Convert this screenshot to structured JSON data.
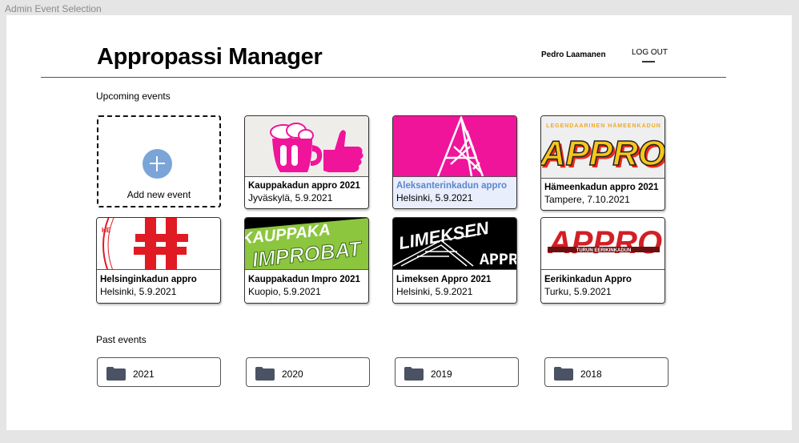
{
  "frame_label": "Admin Event Selection",
  "header": {
    "title": "Appropassi Manager",
    "user_name": "Pedro Laamanen",
    "logout_label": "LOG OUT"
  },
  "upcoming": {
    "label": "Upcoming events",
    "add_label": "Add new event",
    "events": [
      {
        "name": "Kauppakadun appro 2021",
        "date": "Jyväskylä, 5.9.2021"
      },
      {
        "name": "Aleksanterinkadun appro",
        "date": "Helsinki, 5.9.2021",
        "selected": true
      },
      {
        "name": "Hämeenkadun appro 2021",
        "date": "Tampere, 7.10.2021"
      },
      {
        "name": "Helsinginkadun appro",
        "date": "Helsinki, 5.9.2021"
      },
      {
        "name": "Kauppakadun Impro 2021",
        "date": "Kuopio, 5.9.2021"
      },
      {
        "name": "Limeksen Appro 2021",
        "date": "Helsinki, 5.9.2021"
      },
      {
        "name": "Eerikinkadun Appro",
        "date": "Turku, 5.9.2021"
      }
    ]
  },
  "logos": {
    "hameenkatu_top": "LEGENDAARINEN HÄMEENKADUN",
    "hameenkatu_main": "APPRO",
    "kauppakatu_impro_top": "KAUPPAKA",
    "kauppakatu_impro_main": "IMPROBAT",
    "limes_main": "LIMEKSEN",
    "limes_sub": "APPR",
    "eerikinkatu_main": "APPRO",
    "eerikinkatu_band": "TURUN EERIKINKADUN"
  },
  "past": {
    "label": "Past events",
    "folders": [
      "2021",
      "2020",
      "2019",
      "2018"
    ]
  },
  "colors": {
    "accent_blue": "#7aa5d6",
    "selected_text": "#5b86cf",
    "selected_bg": "#e8eefb",
    "magenta": "#f0149b",
    "folder_icon": "#4a5263"
  }
}
